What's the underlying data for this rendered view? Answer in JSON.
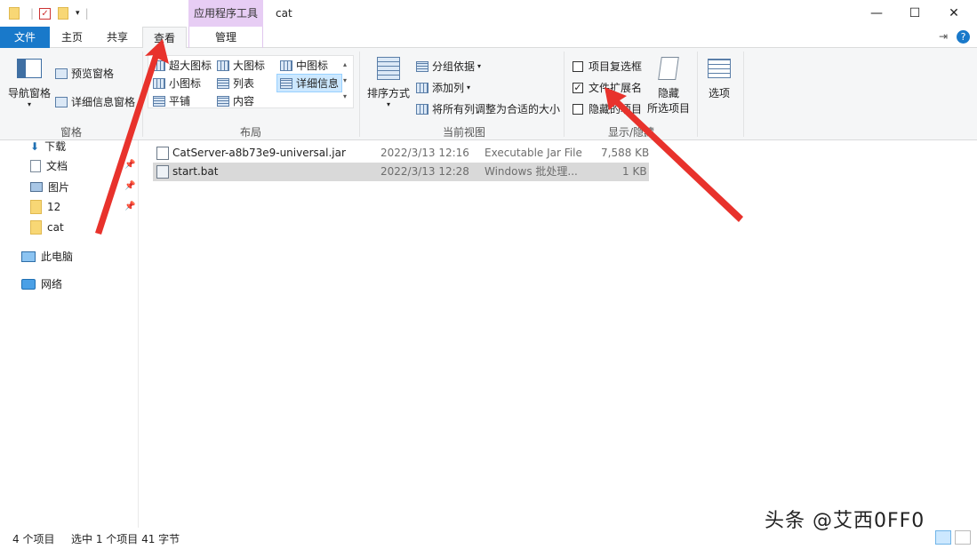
{
  "title_bar": {
    "context_tab_label": "应用程序工具",
    "window_title": "cat",
    "minimize": "—",
    "maximize": "☐",
    "close": "✕"
  },
  "tabs": [
    {
      "label": "文件"
    },
    {
      "label": "主页"
    },
    {
      "label": "共享"
    },
    {
      "label": "查看"
    },
    {
      "label": "管理"
    }
  ],
  "ribbon": {
    "panes": {
      "nav_pane": "导航窗格",
      "preview_pane": "预览窗格",
      "details_pane": "详细信息窗格",
      "group_label": "窗格"
    },
    "layout": {
      "items": [
        "超大图标",
        "大图标",
        "中图标",
        "小图标",
        "列表",
        "详细信息",
        "平铺",
        "内容"
      ],
      "group_label": "布局"
    },
    "current_view": {
      "sort_by": "排序方式",
      "group_by": "分组依据",
      "add_column": "添加列",
      "size_all_columns": "将所有列调整为合适的大小",
      "group_label": "当前视图"
    },
    "show_hide": {
      "item_checkboxes": "项目复选框",
      "item_checkboxes_checked": false,
      "file_extensions": "文件扩展名",
      "file_extensions_checked": true,
      "hidden_items": "隐藏的项目",
      "hidden_items_checked": false,
      "hide_selected_line1": "隐藏",
      "hide_selected_line2": "所选项目",
      "group_label": "显示/隐藏"
    },
    "options": "选项"
  },
  "nav": {
    "items": [
      {
        "label": "下载"
      },
      {
        "label": "文档"
      },
      {
        "label": "图片"
      },
      {
        "label": "12"
      },
      {
        "label": "cat"
      },
      {
        "label": "此电脑"
      },
      {
        "label": "网络"
      }
    ]
  },
  "files": [
    {
      "name": "CatServer-a8b73e9-universal.jar",
      "date": "2022/3/13 12:16",
      "type": "Executable Jar File",
      "size": "7,588 KB",
      "selected": false
    },
    {
      "name": "start.bat",
      "date": "2022/3/13 12:28",
      "type": "Windows 批处理...",
      "size": "1 KB",
      "selected": true
    }
  ],
  "status": {
    "item_count": "4 个项目",
    "selection": "选中 1 个项目  41 字节"
  },
  "watermark": "头条 @艾西0FF0",
  "colors": {
    "file_tab": "#1979ca",
    "context_tab": "#e7cdf4",
    "arrow": "#e8322c",
    "selected_row": "#d9d9d9"
  }
}
